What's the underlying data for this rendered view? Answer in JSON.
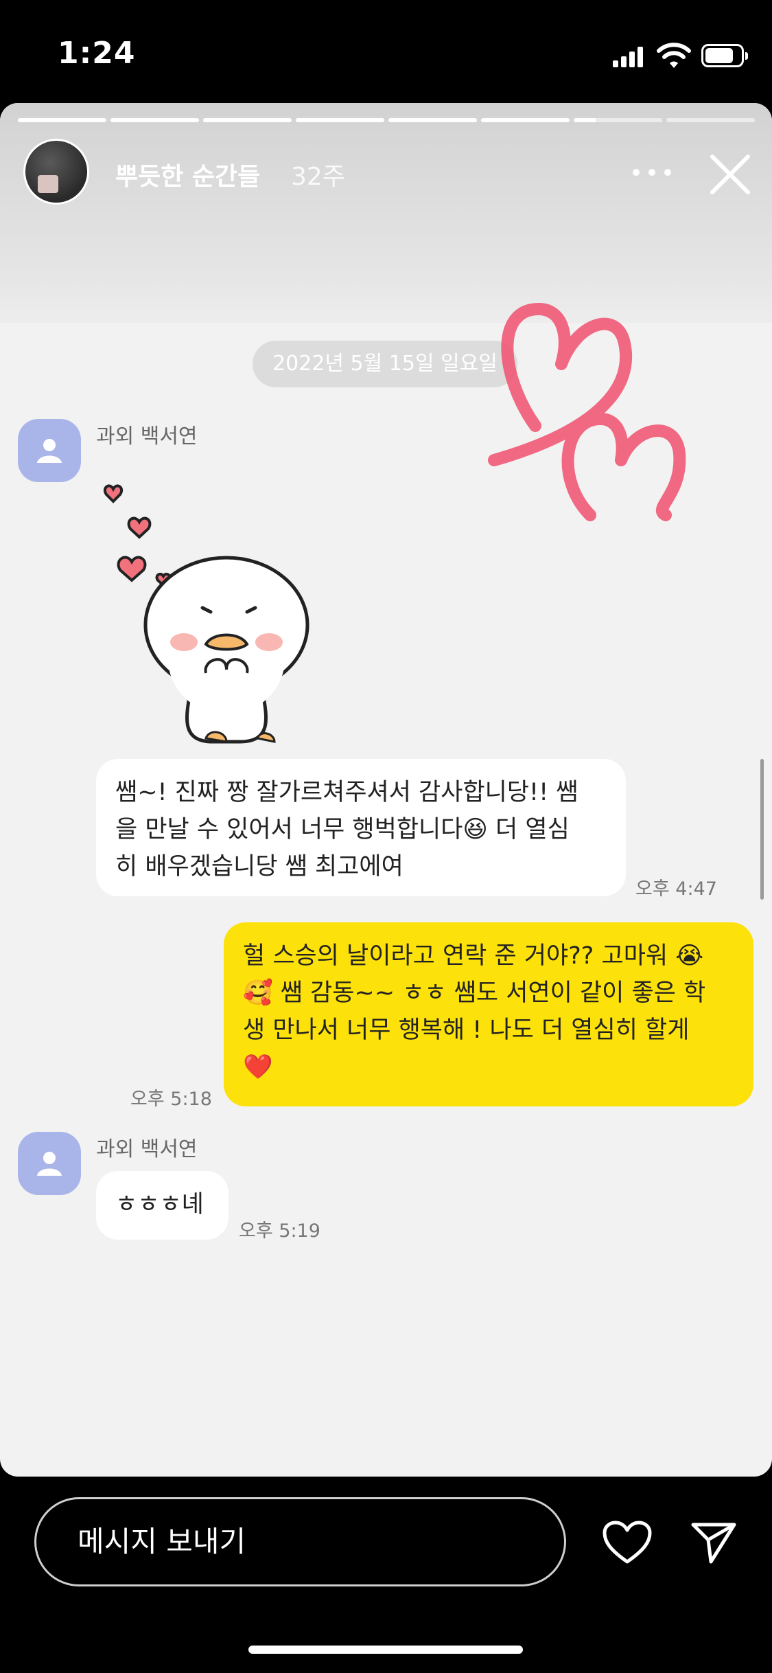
{
  "status_bar": {
    "time": "1:24"
  },
  "story": {
    "name": "뿌듯한 순간들",
    "age": "32주",
    "progress": {
      "segments": 8,
      "completed": 6,
      "current_fraction": 0.25
    }
  },
  "chat": {
    "date_divider": "2022년 5월 15일 일요일",
    "messages": [
      {
        "sender": "과외 백서연",
        "type": "sticker"
      },
      {
        "type": "text",
        "direction": "in",
        "text": "쌤~! 진짜 짱 잘가르쳐주셔서 감사합니당!! 쌤\n을 만날 수 있어서 너무 행벅합니다😆 더 열심\n히 배우겠습니당 쌤 최고에여",
        "time": "오후 4:47"
      },
      {
        "type": "text",
        "direction": "out",
        "text": "헐 스승의 날이라고 연락 준 거야?? 고마워 😭\n🥰 쌤 감동~~ ㅎㅎ 쌤도 서연이 같이 좋은 학\n생 만나서 너무 행복해 ! 나도 더 열심히 할게\n❤️",
        "time": "오후 5:18"
      },
      {
        "sender": "과외 백서연",
        "type": "text",
        "direction": "in",
        "text": "ㅎㅎㅎ녜",
        "time": "오후 5:19"
      }
    ]
  },
  "composer": {
    "placeholder": "메시지 보내기"
  },
  "colors": {
    "incoming_bubble": "#ffffff",
    "outgoing_bubble": "#fde10a",
    "profile": "#a9b4e9",
    "heart_doodle": "#f0506e"
  },
  "icons": {
    "more": "more-icon",
    "close": "close-icon",
    "like": "heart-icon",
    "send": "send-icon",
    "profile": "person-icon"
  }
}
